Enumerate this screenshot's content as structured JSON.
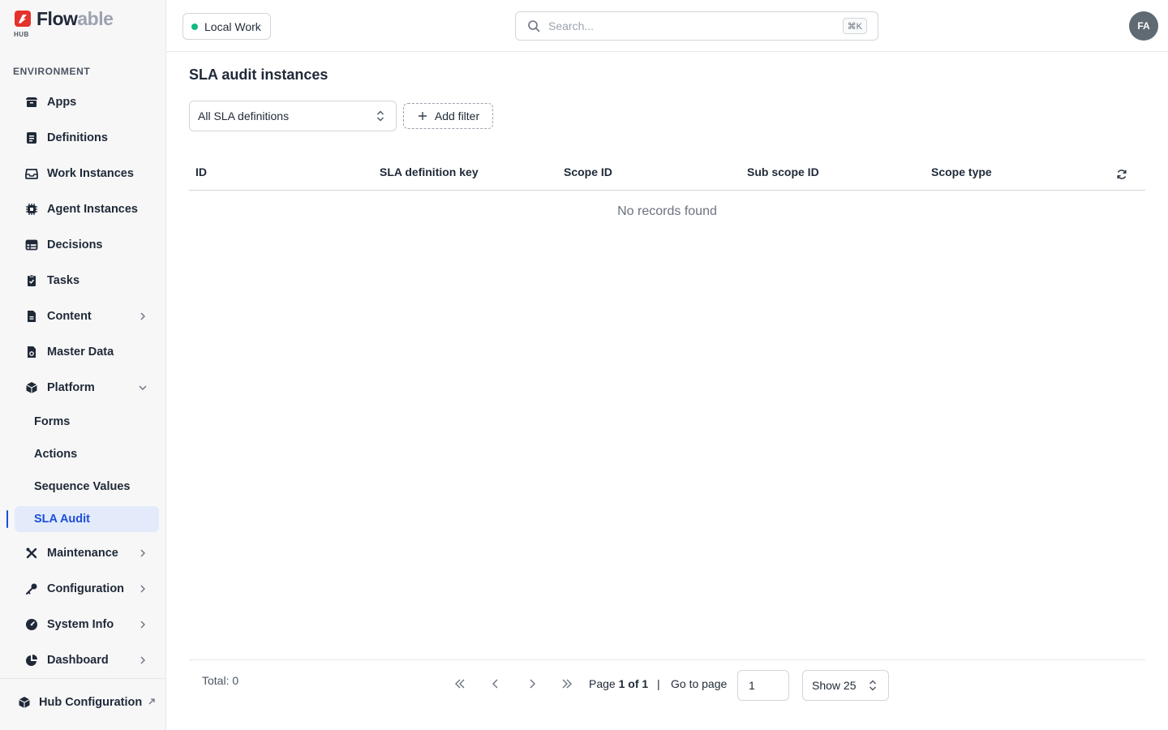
{
  "brand": {
    "name_dark": "Flow",
    "name_light": "able",
    "sub": "HUB",
    "accent": "#e5322d"
  },
  "sidebar": {
    "section_label": "ENVIRONMENT",
    "items": [
      {
        "label": "Apps",
        "icon": "box-icon"
      },
      {
        "label": "Definitions",
        "icon": "document-list-icon"
      },
      {
        "label": "Work Instances",
        "icon": "inbox-icon"
      },
      {
        "label": "Agent Instances",
        "icon": "chip-icon"
      },
      {
        "label": "Decisions",
        "icon": "table-icon"
      },
      {
        "label": "Tasks",
        "icon": "clipboard-check-icon"
      },
      {
        "label": "Content",
        "icon": "file-icon",
        "expandable": true
      },
      {
        "label": "Master Data",
        "icon": "database-file-icon"
      },
      {
        "label": "Platform",
        "icon": "cube-icon",
        "expanded": true
      },
      {
        "label": "Maintenance",
        "icon": "tools-icon",
        "expandable": true
      },
      {
        "label": "Configuration",
        "icon": "key-icon",
        "expandable": true
      },
      {
        "label": "System Info",
        "icon": "gauge-icon",
        "expandable": true
      },
      {
        "label": "Dashboard",
        "icon": "pie-chart-icon",
        "expandable": true
      }
    ],
    "platform_children": [
      {
        "label": "Forms"
      },
      {
        "label": "Actions"
      },
      {
        "label": "Sequence Values"
      },
      {
        "label": "SLA Audit",
        "active": true
      }
    ],
    "footer_item": {
      "label": "Hub Configuration",
      "icon": "cube-icon"
    }
  },
  "topbar": {
    "environment": {
      "label": "Local Work",
      "status_color": "#10b981"
    },
    "search": {
      "placeholder": "Search...",
      "shortcut": "⌘K"
    },
    "avatar_initials": "FA"
  },
  "main": {
    "title": "SLA audit instances",
    "definition_select": "All SLA definitions",
    "add_filter_label": "Add filter",
    "columns": [
      "ID",
      "SLA definition key",
      "Scope ID",
      "Sub scope ID",
      "Scope type"
    ],
    "empty_message": "No records found"
  },
  "pagination": {
    "total_label": "Total: 0",
    "page_prefix": "Page",
    "page_current": "1 of 1",
    "separator": "|",
    "goto_label": "Go to page",
    "goto_value": "1",
    "show_label": "Show 25"
  }
}
